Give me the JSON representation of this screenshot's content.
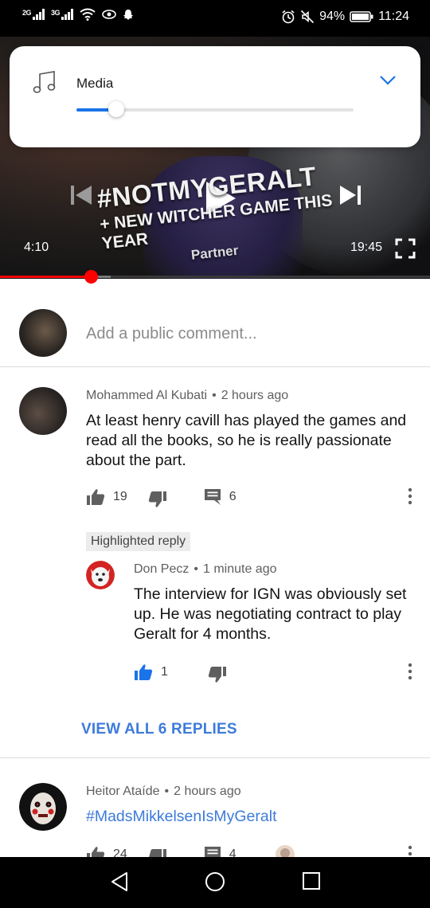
{
  "status_bar": {
    "network_1": "2G",
    "network_2": "3G",
    "battery": "94%",
    "time": "11:24",
    "icons": [
      "signal-icon",
      "wifi-icon",
      "eye-icon",
      "snapchat-icon",
      "alarm-icon",
      "mute-icon",
      "battery-icon"
    ]
  },
  "video": {
    "title_main": "#NOTMYGERALT",
    "title_sub": "+ NEW WITCHER GAME THIS YEAR",
    "partner": "Partner",
    "current_time": "4:10",
    "total_time": "19:45",
    "progress": 0.212,
    "buffered": 0.257
  },
  "media_volume": {
    "label": "Media",
    "level": 0.145,
    "accent": "#1a73e8"
  },
  "comment_box": {
    "placeholder": "Add a public comment..."
  },
  "comments": [
    {
      "author": "Mohammed Al Kubati",
      "age": "2 hours ago",
      "text": "At least henry cavill has played the games and read all the books, so he is really passionate about the part.",
      "likes": "19",
      "replies": "6"
    }
  ],
  "highlighted_reply": {
    "badge": "Highlighted reply",
    "author": "Don Pecz",
    "age": "1 minute ago",
    "text": "The interview for IGN was obviously set up. He was negotiating contract to play Geralt for 4 months.",
    "likes": "1",
    "liked": true
  },
  "view_replies": "VIEW ALL 6 REPLIES",
  "second_comment": {
    "author": "Heitor Ataíde",
    "age": "2 hours ago",
    "text": "#MadsMikkelsenIsMyGeralt",
    "likes": "24",
    "replies": "4"
  },
  "colors": {
    "link_blue": "#3d7bd9",
    "progress_red": "#ff0000",
    "like_active": "#1a73e8"
  }
}
